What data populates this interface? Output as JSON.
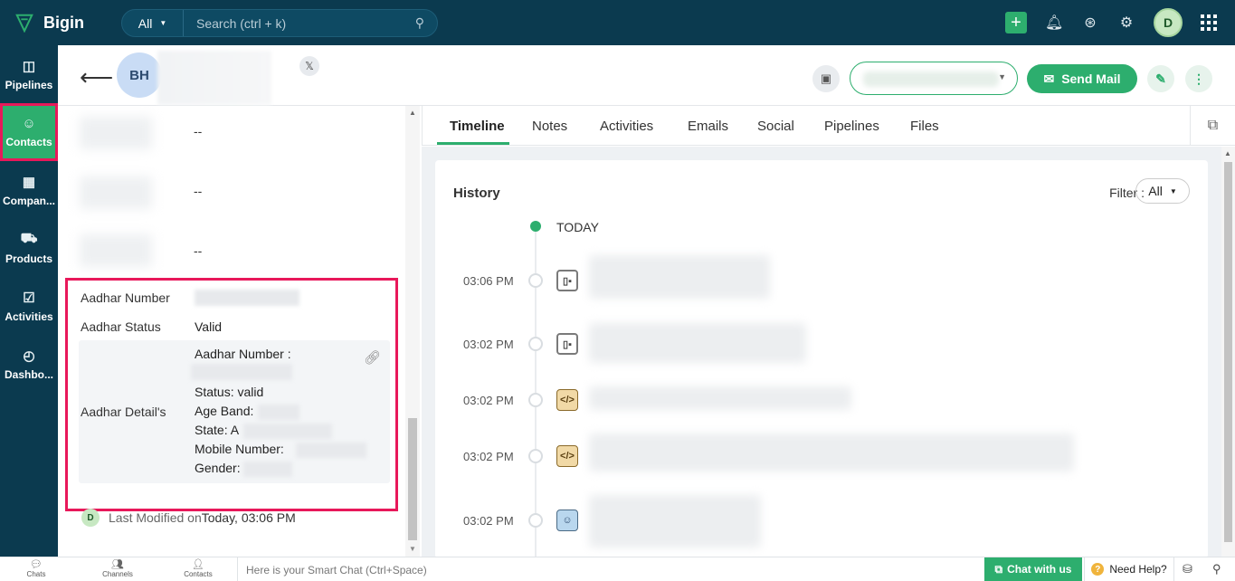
{
  "app": {
    "name": "Bigin"
  },
  "search": {
    "scope": "All",
    "placeholder": "Search (ctrl + k)"
  },
  "topbar": {
    "user_initial": "D"
  },
  "nav": [
    {
      "label": "Pipelines",
      "icon": "pipelines-icon",
      "glyph": "◫"
    },
    {
      "label": "Contacts",
      "icon": "contacts-icon",
      "glyph": "☺",
      "active": true
    },
    {
      "label": "Compan...",
      "icon": "companies-icon",
      "glyph": "▦"
    },
    {
      "label": "Products",
      "icon": "products-icon",
      "glyph": "⛟"
    },
    {
      "label": "Activities",
      "icon": "activities-icon",
      "glyph": "☑"
    },
    {
      "label": "Dashbo...",
      "icon": "dashboards-icon",
      "glyph": "◴"
    }
  ],
  "contact": {
    "initials": "BH",
    "social_badge": "𝕏"
  },
  "header": {
    "send_mail": "Send Mail"
  },
  "fields": [
    {
      "value": "--"
    },
    {
      "value": "--"
    },
    {
      "value": "--"
    }
  ],
  "aadhar": {
    "number_label": "Aadhar Number",
    "status_label": "Aadhar Status",
    "status_value": "Valid",
    "detail_label": "Aadhar Detail's",
    "detail_lines": {
      "number": "Aadhar Number :",
      "status": "Status: valid",
      "age": "Age Band:",
      "state": "State: A",
      "mobile": "Mobile Number:",
      "gender": "Gender:"
    }
  },
  "last_modified": {
    "initial": "D",
    "label": "Last Modified on",
    "value": "Today, 03:06 PM"
  },
  "tabs": [
    "Timeline",
    "Notes",
    "Activities",
    "Emails",
    "Social",
    "Pipelines",
    "Files"
  ],
  "history": {
    "title": "History",
    "filter_label": "Filter :",
    "filter_value": "All",
    "today_label": "TODAY",
    "entries": [
      {
        "time": "03:06 PM",
        "icon": "chat-icon"
      },
      {
        "time": "03:02 PM",
        "icon": "chat-icon"
      },
      {
        "time": "03:02 PM",
        "icon": "code-icon"
      },
      {
        "time": "03:02 PM",
        "icon": "code-icon"
      },
      {
        "time": "03:02 PM",
        "icon": "user-icon"
      }
    ]
  },
  "bottombar": {
    "chats": "Chats",
    "channels": "Channels",
    "contacts": "Contacts",
    "smart_chat_placeholder": "Here is your Smart Chat (Ctrl+Space)",
    "chat_with_us": "Chat with us",
    "need_help": "Need Help?"
  },
  "colors": {
    "primary": "#2dae6e",
    "topbar": "#0b3a4f",
    "highlight": "#e8185a"
  }
}
